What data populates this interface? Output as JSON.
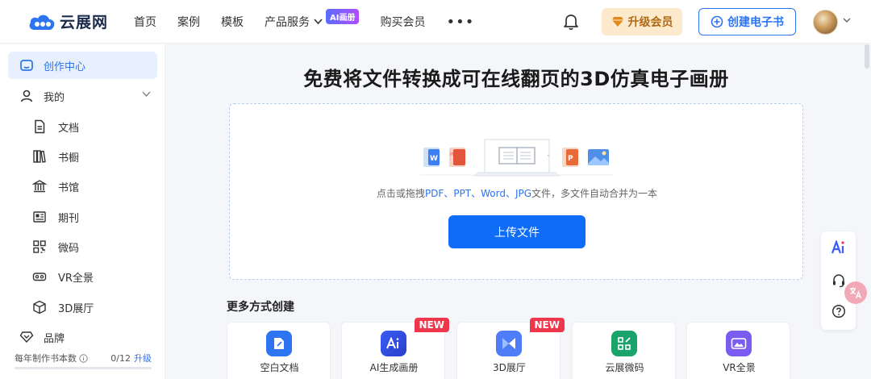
{
  "logo": {
    "text": "云展网"
  },
  "nav": {
    "items": [
      {
        "label": "首页"
      },
      {
        "label": "案例"
      },
      {
        "label": "模板"
      },
      {
        "label": "产品服务"
      },
      {
        "label": "购买会员"
      }
    ],
    "ai_badge": "AI画册",
    "more": "•••"
  },
  "header": {
    "upgrade_label": "升级会员",
    "create_label": "创建电子书"
  },
  "sidebar": {
    "items": [
      {
        "label": "创作中心",
        "icon": "home-icon"
      },
      {
        "label": "我的",
        "icon": "user-icon"
      },
      {
        "label": "文档",
        "icon": "document-icon"
      },
      {
        "label": "书橱",
        "icon": "bookshelf-icon"
      },
      {
        "label": "书馆",
        "icon": "library-icon"
      },
      {
        "label": "期刊",
        "icon": "journal-icon"
      },
      {
        "label": "微码",
        "icon": "qrcode-icon"
      },
      {
        "label": "VR全景",
        "icon": "vr-icon"
      },
      {
        "label": "3D展厅",
        "icon": "cube-icon"
      },
      {
        "label": "品牌",
        "icon": "brand-icon"
      }
    ],
    "quota": {
      "label": "每年制作书本数",
      "value": "0/12",
      "upgrade": "升级",
      "used_fraction": 0
    }
  },
  "main": {
    "title": "免费将文件转换成可在线翻页的3D仿真电子画册",
    "hint_prefix": "点击或拖拽",
    "hint_types": "PDF、PPT、Word、JPG",
    "hint_suffix": "文件，多文件自动合并为一本",
    "upload_label": "上传文件",
    "more_title": "更多方式创建",
    "cards": [
      {
        "label": "空白文档",
        "icon": "blank-doc-icon",
        "color": "#2d74f0"
      },
      {
        "label": "AI生成画册",
        "icon": "ai-icon",
        "color": "#3b5cf5",
        "badge": "NEW"
      },
      {
        "label": "3D展厅",
        "icon": "3d-hall-icon",
        "color": "#4f7cf7",
        "badge": "NEW"
      },
      {
        "label": "云展微码",
        "icon": "qrcode-icon",
        "color": "#1aa36b"
      },
      {
        "label": "VR全景",
        "icon": "vr-icon",
        "color": "#7b5cf0"
      }
    ]
  },
  "colors": {
    "accent": "#2d74f0",
    "upload": "#0e6cf7",
    "new_badge": "#f0364a",
    "upgrade_bg": "#fde9cc"
  }
}
